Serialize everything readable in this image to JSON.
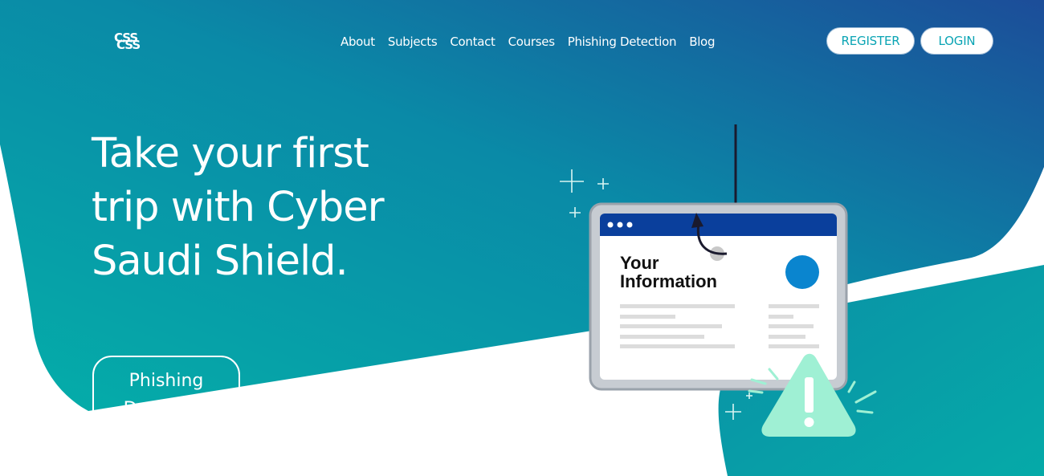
{
  "colors": {
    "gradient_start": "#04a9a8",
    "gradient_end": "#1d4f9a",
    "white": "#ffffff",
    "button_text": "#0aa4b4",
    "card_header": "#003f9c",
    "card_dot": "#0a85cf",
    "warning": "#9ff0d4"
  },
  "brand": {
    "logo_line1": "CSS",
    "logo_line2": "CSS"
  },
  "nav": {
    "items": [
      {
        "label": "About"
      },
      {
        "label": "Subjects"
      },
      {
        "label": "Contact"
      },
      {
        "label": "Courses"
      },
      {
        "label": "Phishing Detection"
      },
      {
        "label": "Blog"
      }
    ]
  },
  "auth": {
    "register_label": "REGISTER",
    "login_label": "LOGIN"
  },
  "hero": {
    "title": "Take your first trip with Cyber Saudi Shield.",
    "cta_label": "Phishing Detection"
  },
  "illustration": {
    "card_title_line1": "Your",
    "card_title_line2": "Information",
    "icons": [
      "fish-hook-icon",
      "warning-icon",
      "sparkle-icon"
    ]
  }
}
